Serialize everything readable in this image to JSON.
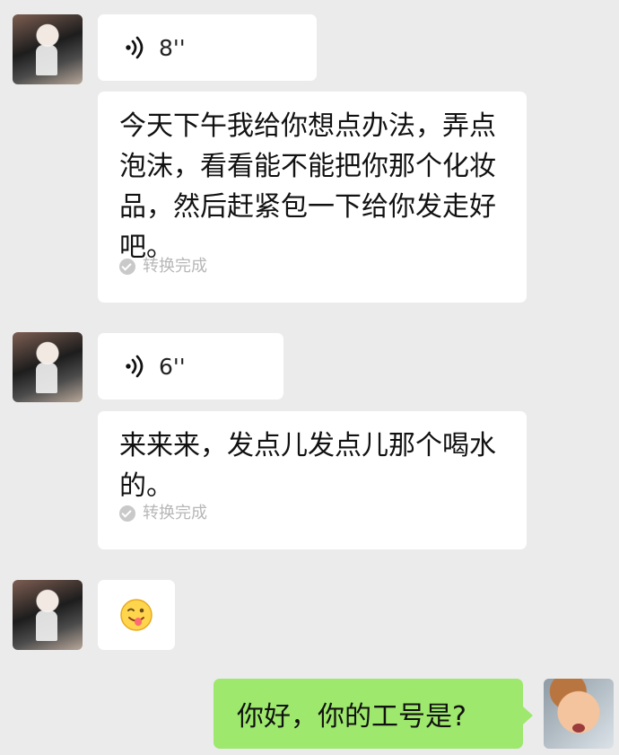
{
  "messages": [
    {
      "voice_duration": "8''",
      "transcription": "今天下午我给你想点办法，弄点泡沫，看看能不能把你那个化妆品，然后赶紧包一下给你发走好吧。",
      "status": "转换完成"
    },
    {
      "voice_duration": "6''",
      "transcription": "来来来，发点儿发点儿那个喝水的。",
      "status": "转换完成"
    },
    {
      "emoji": "wink-tongue-emoji-icon"
    },
    {
      "outgoing_text": "你好，你的工号是?"
    }
  ]
}
